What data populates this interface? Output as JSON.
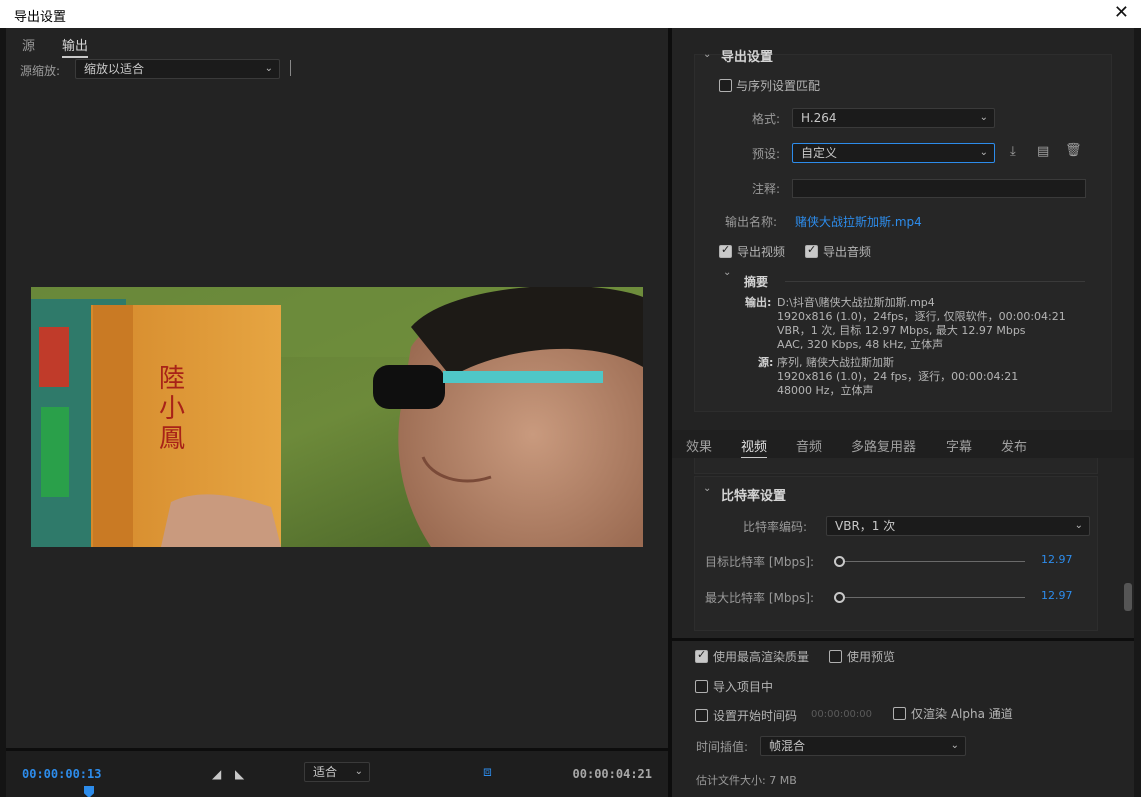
{
  "window": {
    "title": "导出设置",
    "close_glyph": "✕"
  },
  "left_panel": {
    "tabs": [
      {
        "label": "源"
      },
      {
        "label": "输出"
      }
    ],
    "scale_label": "源缩放:",
    "scale_value": "缩放以适合",
    "timecode_start": "00:00:00:13",
    "timecode_end": "00:00:04:21",
    "fit_value": "适合",
    "fit_arrow": "⌄"
  },
  "export_settings": {
    "title": "导出设置",
    "match_sequence": {
      "label": "与序列设置匹配",
      "checked": false
    },
    "format": {
      "label": "格式:",
      "value": "H.264"
    },
    "preset": {
      "label": "预设:",
      "value": "自定义"
    },
    "comment": {
      "label": "注释:",
      "value": ""
    },
    "output_name": {
      "label": "输出名称:",
      "value": "赌侠大战拉斯加斯.mp4"
    },
    "export_video": {
      "label": "导出视频",
      "checked": true
    },
    "export_audio": {
      "label": "导出音频",
      "checked": true
    },
    "summary": {
      "title": "摘要",
      "output_label": "输出:",
      "output_lines": [
        "D:\\抖音\\赌侠大战拉斯加斯.mp4",
        "1920x816 (1.0)，24fps，逐行, 仅限软件，00:00:04:21",
        "VBR，1 次, 目标 12.97 Mbps, 最大 12.97 Mbps",
        "AAC, 320 Kbps, 48  kHz, 立体声"
      ],
      "source_label": "源:",
      "source_lines": [
        "序列, 赌侠大战拉斯加斯",
        "1920x816 (1.0)，24 fps，逐行，00:00:04:21",
        "48000 Hz，立体声"
      ]
    }
  },
  "tabs": [
    {
      "label": "效果"
    },
    {
      "label": "视频"
    },
    {
      "label": "音频"
    },
    {
      "label": "多路复用器"
    },
    {
      "label": "字幕"
    },
    {
      "label": "发布"
    }
  ],
  "bitrate": {
    "title": "比特率设置",
    "encoding": {
      "label": "比特率编码:",
      "value": "VBR，1 次"
    },
    "target": {
      "label": "目标比特率 [Mbps]:",
      "value": "12.97",
      "fraction": 0.02
    },
    "max": {
      "label": "最大比特率 [Mbps]:",
      "value": "12.97",
      "fraction": 0.02
    }
  },
  "options": {
    "max_render_quality": {
      "label": "使用最高渲染质量",
      "checked": true
    },
    "use_previews": {
      "label": "使用预览",
      "checked": false
    },
    "import_into_project": {
      "label": "导入项目中",
      "checked": false
    },
    "set_start_timecode": {
      "label": "设置开始时间码",
      "value": "00:00:00:00",
      "checked": false
    },
    "render_alpha_only": {
      "label": "仅渲染 Alpha 通道",
      "checked": false
    },
    "time_interpolation": {
      "label": "时间插值:",
      "value": "帧混合"
    },
    "estimated_size": "估计文件大小: 7 MB"
  },
  "icons": {
    "save_preset": "save-preset-icon",
    "import_preset": "import-preset-icon",
    "delete_preset": "delete-preset-icon",
    "mark_in": "mark-in-icon",
    "mark_out": "mark-out-icon",
    "aspect": "aspect-ratio-icon"
  },
  "colors": {
    "accent": "#2d8ceb",
    "background": "#232323"
  }
}
